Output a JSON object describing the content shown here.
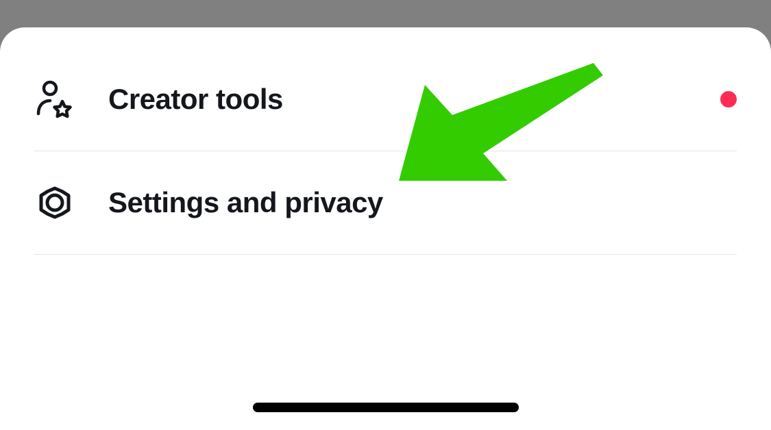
{
  "menu": {
    "items": [
      {
        "id": "creator-tools",
        "label": "Creator tools",
        "icon": "creator-star-icon",
        "badge": true
      },
      {
        "id": "settings-privacy",
        "label": "Settings and privacy",
        "icon": "gear-icon",
        "badge": false
      }
    ]
  },
  "annotation": {
    "type": "arrow",
    "color": "#33cc00",
    "target": "settings-privacy"
  },
  "colors": {
    "badge": "#fe2c55",
    "arrow": "#33cc00",
    "text": "#14171b"
  }
}
